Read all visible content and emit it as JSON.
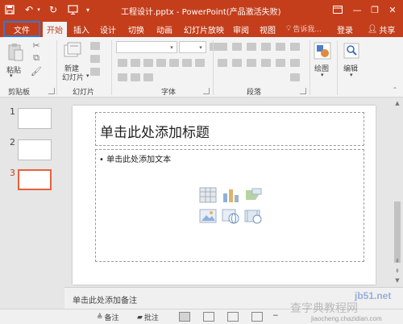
{
  "titlebar": {
    "title": "工程设计.pptx - PowerPoint(产品激活失败)",
    "save_icon": "▣",
    "undo_icon": "↶",
    "redo_icon": "↻",
    "customize_icon": "⚙",
    "ribbon_options_icon": "▭",
    "minimize_icon": "—",
    "restore_icon": "❐",
    "close_icon": "✕"
  },
  "tabs": {
    "file": "文件",
    "home": "开始",
    "insert": "插入",
    "design": "设计",
    "transitions": "切换",
    "animations": "动画",
    "slideshow": "幻灯片放映",
    "review": "审阅",
    "view": "视图",
    "tellme": "告诉我...",
    "signin": "登录",
    "share": "共享"
  },
  "ribbon": {
    "paste_label": "粘贴",
    "clipboard_group": "剪贴板",
    "new_slide_label": "新建",
    "new_slide_label2": "幻灯片",
    "slides_group": "幻灯片",
    "font_group": "字体",
    "paragraph_group": "段落",
    "drawing_label": "绘图",
    "editing_label": "编辑"
  },
  "thumbnails": {
    "slide1": "1",
    "slide2": "2",
    "slide3": "3"
  },
  "slide": {
    "title_placeholder": "单击此处添加标题",
    "body_placeholder": "• 单击此处添加文本"
  },
  "notes": {
    "placeholder": "单击此处添加备注"
  },
  "statusbar": {
    "notes_label": "备注",
    "comments_label": "批注"
  },
  "watermark": {
    "site": "jb51.net",
    "brand": "查字典教程网",
    "url": "jiaocheng.chazidian.com"
  }
}
